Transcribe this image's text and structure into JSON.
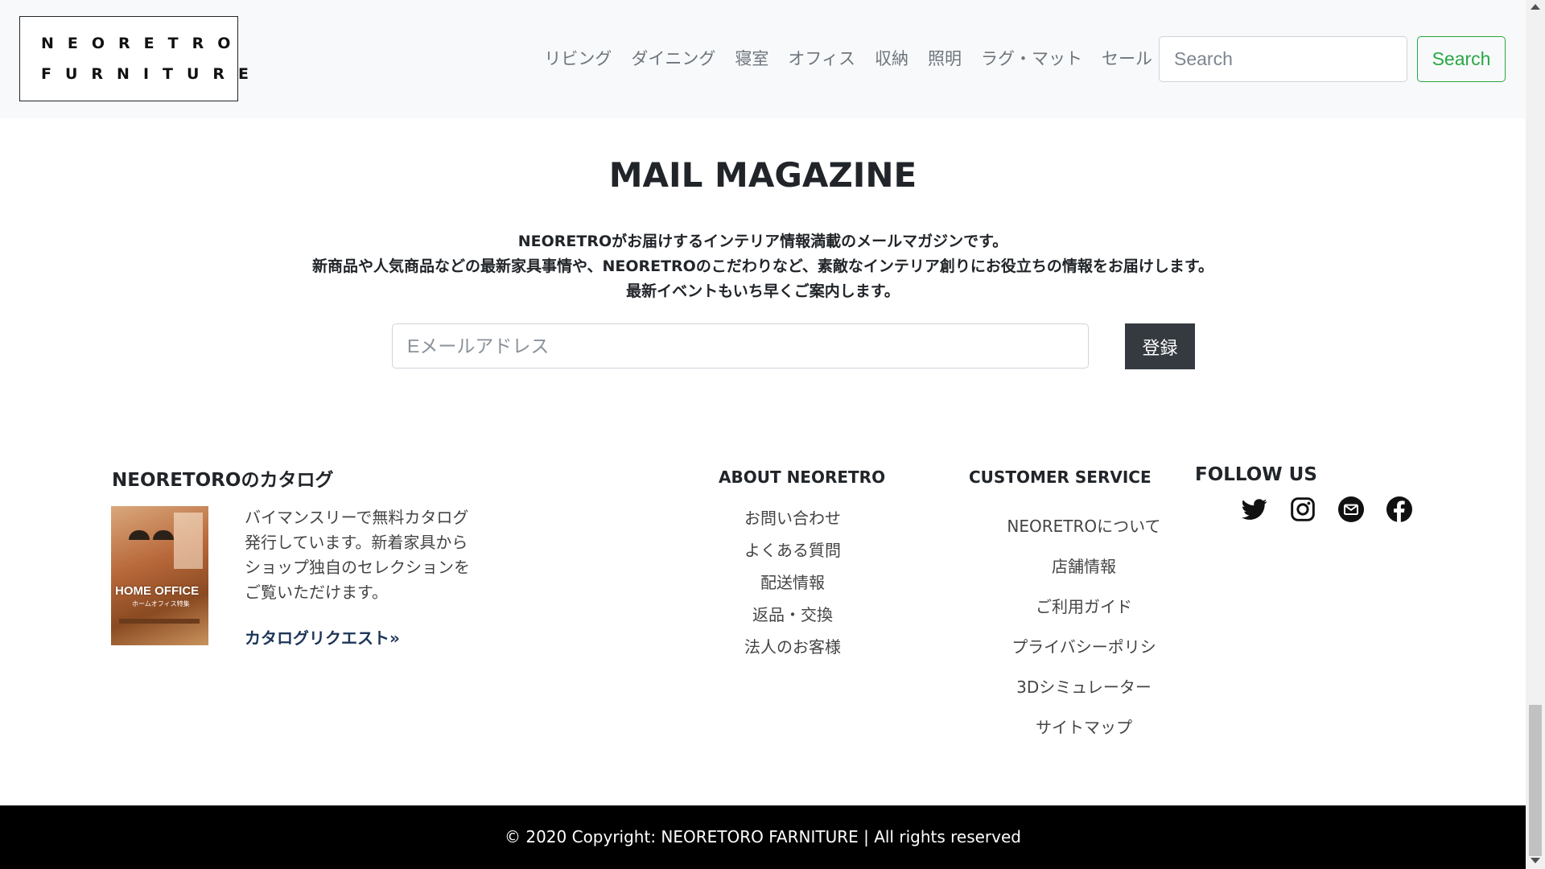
{
  "header": {
    "logo_line1": "NEORETRO",
    "logo_line2": "FURNITURE",
    "nav": [
      "リビング",
      "ダイニング",
      "寝室",
      "オフィス",
      "収納",
      "照明",
      "ラグ・マット",
      "セール"
    ],
    "search_placeholder": "Search",
    "search_button": "Search"
  },
  "mail_magazine": {
    "title": "MAIL MAGAZINE",
    "desc_lines": [
      "NEORETROがお届けするインテリア情報満載のメールマガジンです。",
      "新商品や人気商品などの最新家具事情や、NEORETROのこだわりなど、素敵なインテリア創りにお役立ちの情報をお届けします。",
      "最新イベントもいち早くご案内します。"
    ],
    "email_placeholder": "Eメールアドレス",
    "submit": "登録"
  },
  "catalog": {
    "title": "NEORETOROのカタログ",
    "image_caption": "HOME OFFICE",
    "image_subcaption": "ホームオフィス特集",
    "text": "バイマンスリーで無料カタログ発行しています。新着家具からショップ独自のセレクションをご覧いただけます。",
    "link": "カタログリクエスト»"
  },
  "about": {
    "title": "ABOUT NEORETRO",
    "items": [
      "お問い合わせ",
      "よくある質問",
      "配送情報",
      "返品・交換",
      "法人のお客様"
    ]
  },
  "customer_service": {
    "title": "CUSTOMER SERVICE",
    "items": [
      "NEORETROについて",
      "店舗情報",
      "ご利用ガイド",
      "プライバシーポリシ",
      "3Dシミュレーター",
      "サイトマップ"
    ]
  },
  "follow": {
    "title": "FOLLOW US",
    "icons": [
      "twitter-icon",
      "instagram-icon",
      "mail-icon",
      "facebook-icon"
    ]
  },
  "footer": {
    "copyright": "© 2020 Copyright: NEORETORO FARNITURE | All rights reserved"
  },
  "colors": {
    "accent_green": "#28a745",
    "dark_button": "#343a40",
    "nav_bg": "#f8f9fa",
    "footer_bg": "#000000"
  }
}
